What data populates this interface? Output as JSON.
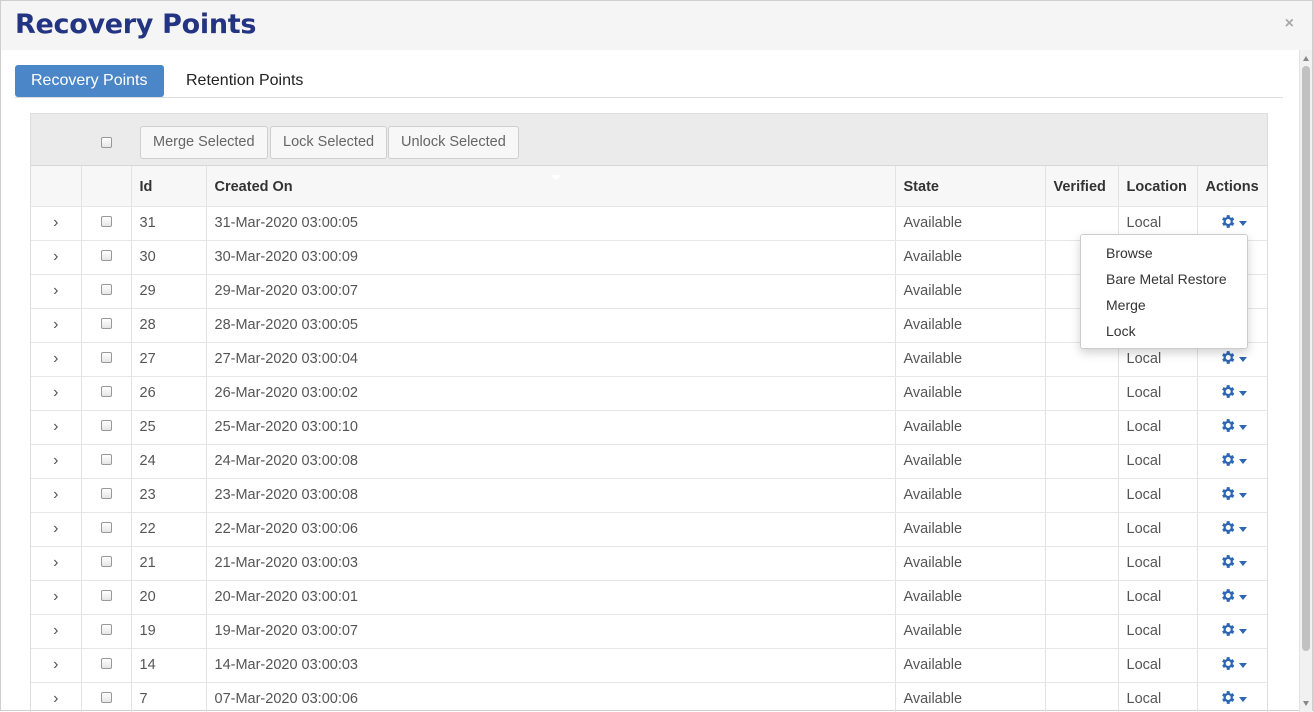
{
  "header": {
    "title": "Recovery Points",
    "close_label": "×"
  },
  "tabs": [
    {
      "label": "Recovery Points",
      "active": true
    },
    {
      "label": "Retention Points",
      "active": false
    }
  ],
  "toolbar": {
    "merge_label": "Merge Selected",
    "lock_label": "Lock Selected",
    "unlock_label": "Unlock Selected"
  },
  "table": {
    "columns": [
      "",
      "",
      "Id",
      "Created On",
      "State",
      "Verified",
      "Location",
      "Actions"
    ],
    "rows": [
      {
        "id": "31",
        "created": "31-Mar-2020 03:00:05",
        "state": "Available",
        "verified": "",
        "location": "Local"
      },
      {
        "id": "30",
        "created": "30-Mar-2020 03:00:09",
        "state": "Available",
        "verified": "",
        "location": ""
      },
      {
        "id": "29",
        "created": "29-Mar-2020 03:00:07",
        "state": "Available",
        "verified": "",
        "location": ""
      },
      {
        "id": "28",
        "created": "28-Mar-2020 03:00:05",
        "state": "Available",
        "verified": "",
        "location": ""
      },
      {
        "id": "27",
        "created": "27-Mar-2020 03:00:04",
        "state": "Available",
        "verified": "",
        "location": "Local"
      },
      {
        "id": "26",
        "created": "26-Mar-2020 03:00:02",
        "state": "Available",
        "verified": "",
        "location": "Local"
      },
      {
        "id": "25",
        "created": "25-Mar-2020 03:00:10",
        "state": "Available",
        "verified": "",
        "location": "Local"
      },
      {
        "id": "24",
        "created": "24-Mar-2020 03:00:08",
        "state": "Available",
        "verified": "",
        "location": "Local"
      },
      {
        "id": "23",
        "created": "23-Mar-2020 03:00:08",
        "state": "Available",
        "verified": "",
        "location": "Local"
      },
      {
        "id": "22",
        "created": "22-Mar-2020 03:00:06",
        "state": "Available",
        "verified": "",
        "location": "Local"
      },
      {
        "id": "21",
        "created": "21-Mar-2020 03:00:03",
        "state": "Available",
        "verified": "",
        "location": "Local"
      },
      {
        "id": "20",
        "created": "20-Mar-2020 03:00:01",
        "state": "Available",
        "verified": "",
        "location": "Local"
      },
      {
        "id": "19",
        "created": "19-Mar-2020 03:00:07",
        "state": "Available",
        "verified": "",
        "location": "Local"
      },
      {
        "id": "14",
        "created": "14-Mar-2020 03:00:03",
        "state": "Available",
        "verified": "",
        "location": "Local"
      },
      {
        "id": "7",
        "created": "07-Mar-2020 03:00:06",
        "state": "Available",
        "verified": "",
        "location": "Local"
      }
    ]
  },
  "action_menu": {
    "open_on_row_id": "31",
    "items": [
      "Browse",
      "Bare Metal Restore",
      "Merge",
      "Lock"
    ]
  },
  "icons": {
    "expand": "chevron-right-icon",
    "actions": "gear-icon",
    "close": "close-icon"
  },
  "colors": {
    "title": "#233582",
    "active_tab": "#4a86c8",
    "gear": "#2f66b3"
  }
}
